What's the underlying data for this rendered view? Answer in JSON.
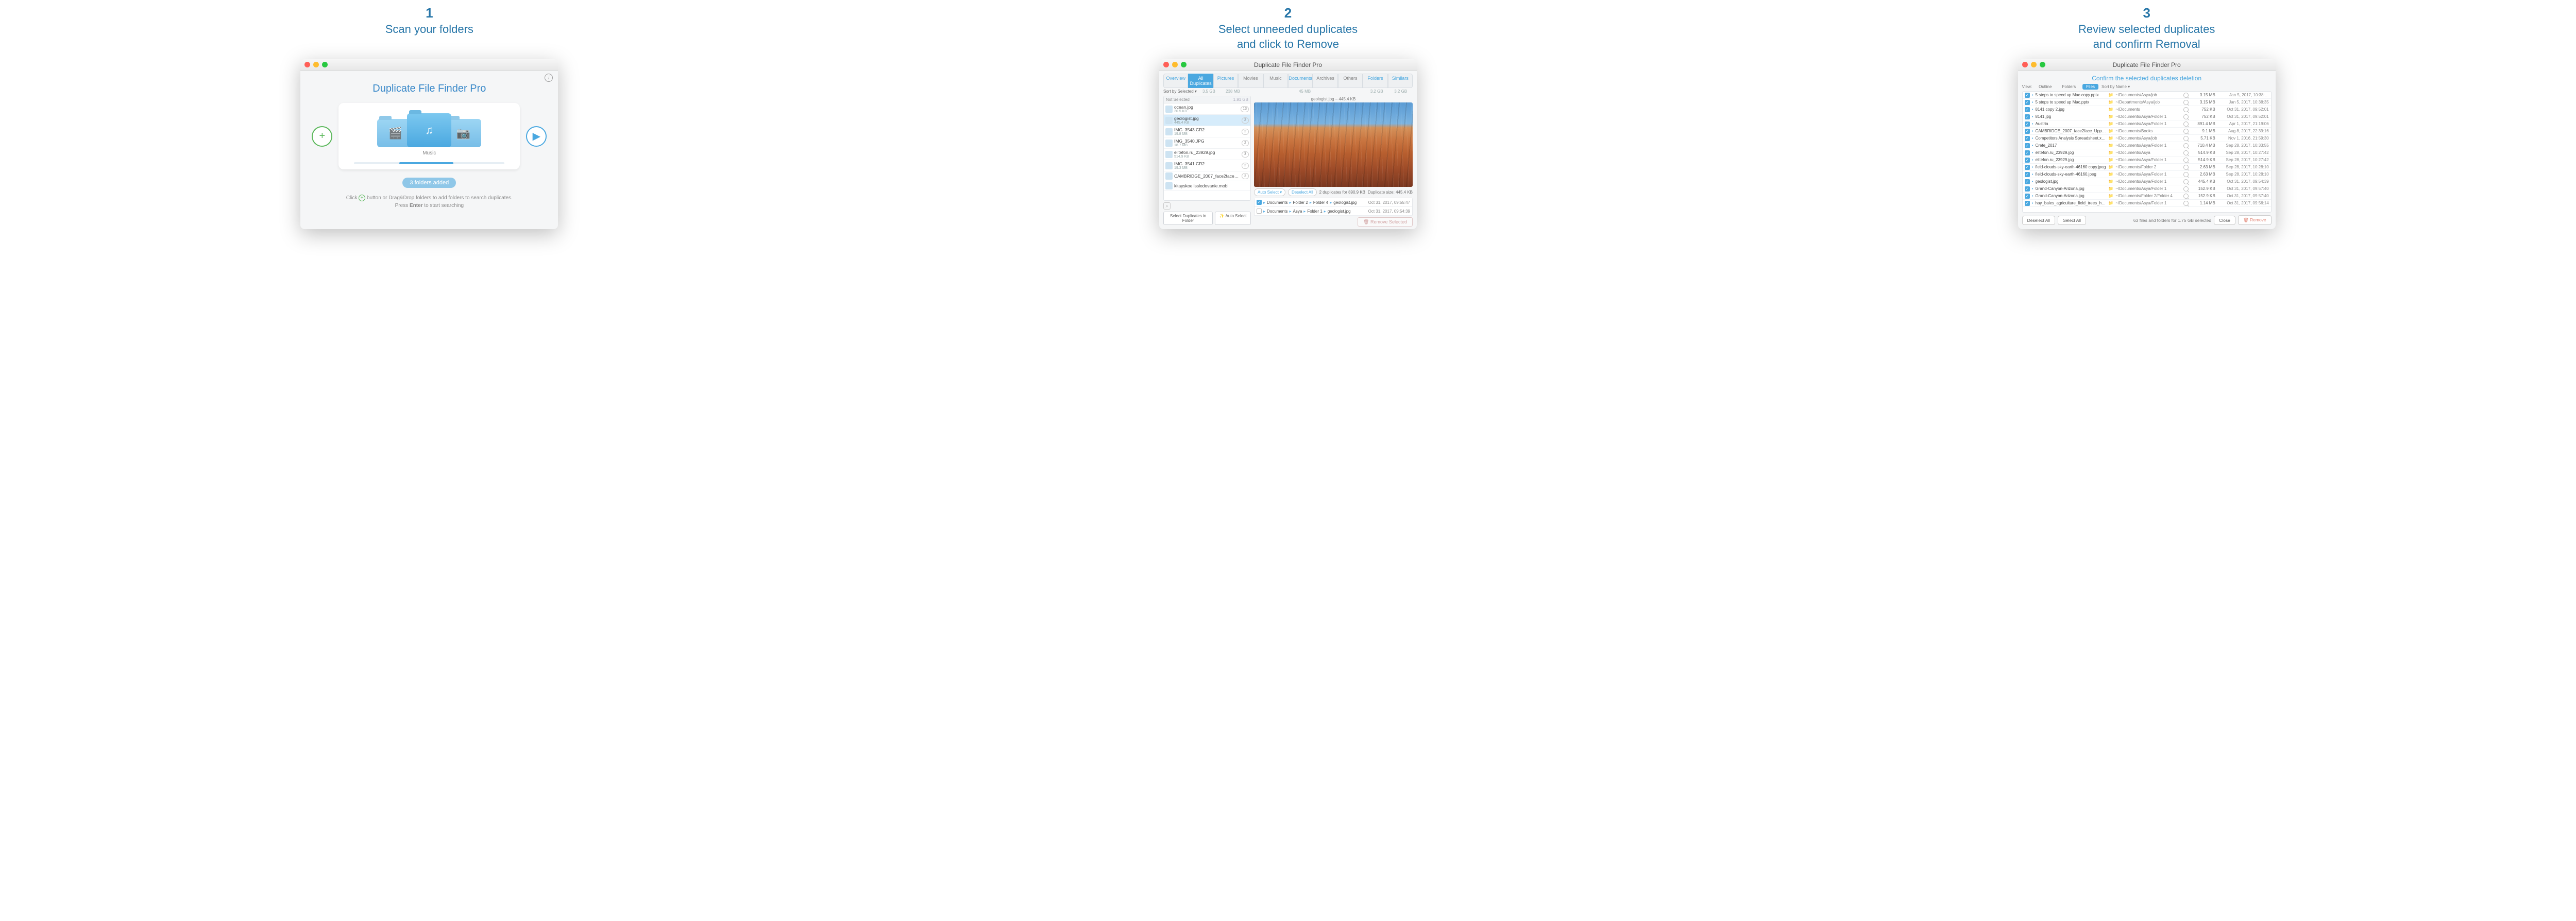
{
  "steps": [
    {
      "num": "1",
      "caption": "Scan your folders"
    },
    {
      "num": "2",
      "caption": "Select unneeded duplicates\nand click to Remove"
    },
    {
      "num": "3",
      "caption": "Review selected duplicates\nand confirm Removal"
    }
  ],
  "window_title": "Duplicate File Finder Pro",
  "s1": {
    "app_title": "Duplicate File Finder Pro",
    "folder_label": "Music",
    "badge": "3 folders added",
    "hint1_a": "Click ",
    "hint1_b": " button or Drag&Drop folders to add folders to search duplicates.",
    "hint2_a": "Press ",
    "hint2_b": "Enter",
    "hint2_c": " to start searching"
  },
  "s2": {
    "tabs": [
      "Overview",
      "All Duplicates",
      "Pictures",
      "Movies",
      "Music",
      "Documents",
      "Archives",
      "Others",
      "Folders",
      "Similars"
    ],
    "sort_label": "Sort by Selected ▾",
    "sizes": [
      "3.5 GB",
      "238 MB",
      "",
      "",
      "45 MB",
      "",
      "",
      "3.2 GB",
      "3.2 GB"
    ],
    "not_selected": "Not Selected",
    "not_selected_sz": "1.91 GB",
    "files": [
      {
        "name": "ocean.jpg",
        "size": "20.5 KB",
        "count": "13"
      },
      {
        "name": "geologist.jpg",
        "size": "445.4 KB",
        "count": "2",
        "sel": true
      },
      {
        "name": "IMG_3543.CR2",
        "size": "19.8 MB",
        "count": "2"
      },
      {
        "name": "IMG_3540.JPG",
        "size": "18.7 MB",
        "count": "2"
      },
      {
        "name": "elitefon.ru_23929.jpg",
        "size": "514.9 KB",
        "count": "3"
      },
      {
        "name": "IMG_3541.CR2",
        "size": "19.3 MB",
        "count": "2"
      },
      {
        "name": "CAMBRIDGE_2007_face2face_UpperInt…",
        "size": "",
        "count": "2"
      },
      {
        "name": "kitayskoe issledovanie.mobi",
        "size": "",
        "count": ""
      }
    ],
    "btn_select_folder": "Select Duplicates in Folder",
    "btn_auto_select": "✨ Auto Select",
    "preview_title": "geologist.jpg – 445.4 KB",
    "auto_sel": "Auto Select ▾",
    "deselect": "Deselect All",
    "dup_info": "2 duplicates for 890.9 KB",
    "dup_size": "Duplicate size: 445.4 KB",
    "paths": [
      {
        "checked": true,
        "crumbs": [
          "Documents",
          "Folder 2",
          "Folder 4",
          "geologist.jpg"
        ],
        "date": "Oct 31, 2017, 09:55:47"
      },
      {
        "checked": false,
        "crumbs": [
          "Documents",
          "Asya",
          "Folder 1",
          "geologist.jpg"
        ],
        "date": "Oct 31, 2017, 09:54:39"
      }
    ],
    "remove": "🗑 Remove Selected"
  },
  "s3": {
    "confirm": "Confirm the selected duplicates deletion",
    "view_label": "View:",
    "view_tabs": [
      "Outline",
      "Folders",
      "Files"
    ],
    "sort": "Sort by Name ▾",
    "rows": [
      {
        "c": true,
        "n": "5 steps to speed up Mac copy.pptx",
        "p": "~/Documents/Asya/job",
        "s": "3.15 MB",
        "d": "Jan 5, 2017, 10:38:…"
      },
      {
        "c": true,
        "n": "5 steps to speed up Mac.pptx",
        "p": "~/Departments/Asya/job",
        "s": "3.15 MB",
        "d": "Jan 5, 2017, 10:38:35"
      },
      {
        "c": true,
        "n": "8141 copy 2.jpg",
        "p": "~/Documents",
        "s": "752 KB",
        "d": "Oct 31, 2017, 09:52:01"
      },
      {
        "c": true,
        "n": "8141.jpg",
        "p": "~/Documents/Asya/Folder 1",
        "s": "752 KB",
        "d": "Oct 31, 2017, 09:52:01"
      },
      {
        "c": true,
        "n": "Austria",
        "p": "~/Documents/Asya/Folder 1",
        "s": "891.4 MB",
        "d": "Apr 1, 2017, 21:19:06"
      },
      {
        "c": true,
        "n": "CAMBRIDGE_2007_face2face_UpperInt…",
        "p": "~/Documents/Books",
        "s": "9.1 MB",
        "d": "Aug 8, 2017, 22:39:16"
      },
      {
        "c": true,
        "n": "Competitors Analysis Spreadsheet.xlsx",
        "p": "~/Documents/Asya/job",
        "s": "5.71 KB",
        "d": "Nov 1, 2016, 21:59:30"
      },
      {
        "c": true,
        "n": "Crete_2017",
        "p": "~/Documents/Asya/Folder 1",
        "s": "710.4 MB",
        "d": "Sep 28, 2017, 10:33:55"
      },
      {
        "c": true,
        "n": "elitefon.ru_23929.jpg",
        "p": "~/Documents/Asya",
        "s": "514.9 KB",
        "d": "Sep 28, 2017, 10:27:42"
      },
      {
        "c": true,
        "n": "elitefon.ru_23929.jpg",
        "p": "~/Documents/Asya/Folder 1",
        "s": "514.9 KB",
        "d": "Sep 28, 2017, 10:27:42"
      },
      {
        "c": true,
        "n": "field-clouds-sky-earth-46160 copy.jpeg",
        "p": "~/Documents/Folder 2",
        "s": "2.63 MB",
        "d": "Sep 28, 2017, 10:28:10"
      },
      {
        "c": true,
        "n": "field-clouds-sky-earth-46160.jpeg",
        "p": "~/Documents/Asya/Folder 1",
        "s": "2.63 MB",
        "d": "Sep 28, 2017, 10:28:10"
      },
      {
        "c": true,
        "n": "geologist.jpg",
        "p": "~/Documents/Asya/Folder 1",
        "s": "445.4 KB",
        "d": "Oct 31, 2017, 09:54:39"
      },
      {
        "c": true,
        "n": "Grand-Canyon-Arizona.jpg",
        "p": "~/Documents/Asya/Folder 1",
        "s": "152.9 KB",
        "d": "Oct 31, 2017, 09:57:40"
      },
      {
        "c": true,
        "n": "Grand-Canyon-Arizona.jpg",
        "p": "~/Documents/Folder 2/Folder 4",
        "s": "152.9 KB",
        "d": "Oct 31, 2017, 09:57:40"
      },
      {
        "c": true,
        "n": "hay_bales_agriculture_field_trees_house…",
        "p": "~/Documents/Asya/Folder 1",
        "s": "1.14 MB",
        "d": "Oct 31, 2017, 09:56:14"
      }
    ],
    "deselect": "Deselect All",
    "select_all": "Select All",
    "summary": "63 files and folders for 1.75 GB selected",
    "close": "Close",
    "remove": "🗑 Remove"
  }
}
